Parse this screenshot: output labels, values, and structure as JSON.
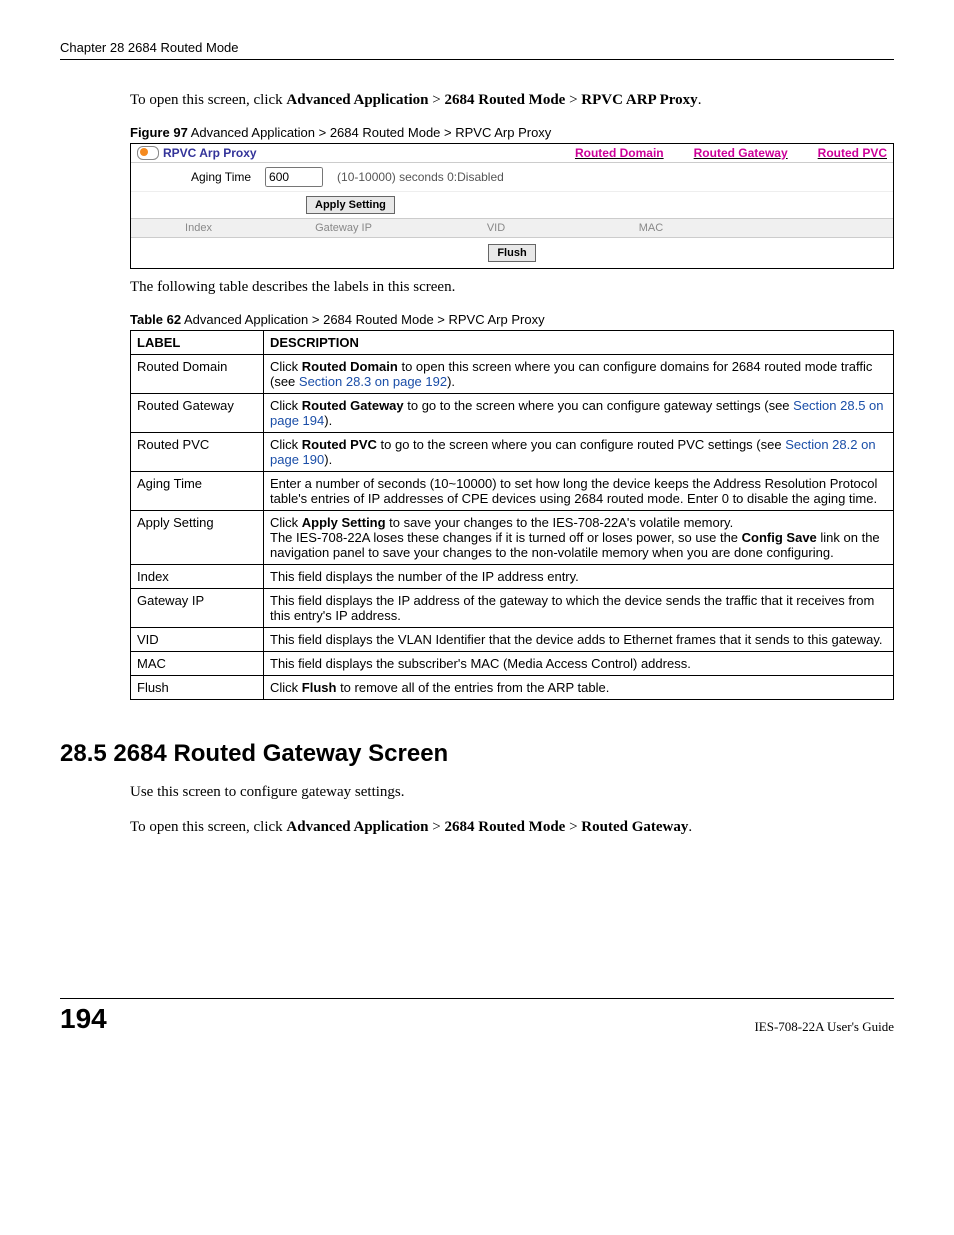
{
  "header": {
    "chapter": "Chapter 28 2684 Routed Mode"
  },
  "intro": {
    "prefix": "To open this screen, click ",
    "path1": "Advanced Application",
    "sep": " > ",
    "path2": "2684 Routed Mode",
    "path3": "RPVC ARP Proxy",
    "period": "."
  },
  "figure": {
    "caption_b": "Figure 97",
    "caption_r": "   Advanced Application > 2684 Routed Mode > RPVC Arp Proxy",
    "title": "RPVC Arp Proxy",
    "links": [
      "Routed Domain",
      "Routed Gateway",
      "Routed PVC"
    ],
    "aging_label": "Aging Time",
    "aging_value": "600",
    "aging_hint": "(10-10000) seconds  0:Disabled",
    "apply_btn": "Apply Setting",
    "cols": [
      "Index",
      "Gateway IP",
      "VID",
      "MAC"
    ],
    "flush_btn": "Flush"
  },
  "after_fig": "The following table describes the labels in this screen.",
  "table": {
    "caption_b": "Table 62",
    "caption_r": "   Advanced Application > 2684 Routed Mode > RPVC Arp Proxy",
    "head": [
      "LABEL",
      "DESCRIPTION"
    ],
    "rows": [
      {
        "label": "Routed Domain",
        "b1": "Routed Domain",
        "pre": "Click ",
        "post": " to open this screen where you can configure domains for 2684 routed mode traffic (see ",
        "xref": "Section 28.3 on page 192",
        "tail": ")."
      },
      {
        "label": "Routed Gateway",
        "b1": "Routed Gateway",
        "pre": "Click ",
        "post": " to go to the screen where you can configure gateway settings (see ",
        "xref": "Section 28.5 on page 194",
        "tail": ")."
      },
      {
        "label": "Routed PVC",
        "b1": "Routed PVC",
        "pre": "Click ",
        "post": " to go to the screen where you can configure routed PVC settings (see ",
        "xref": "Section 28.2 on page 190",
        "tail": ")."
      },
      {
        "label": "Aging Time",
        "plain": "Enter a number of seconds (10~10000) to set how long the device keeps the Address Resolution Protocol table's entries of IP addresses of CPE devices using 2684 routed mode. Enter 0 to disable the aging time."
      },
      {
        "label": "Apply Setting",
        "b1": "Apply Setting",
        "pre": "Click ",
        "post": " to save your changes to the IES-708-22A's volatile memory.",
        "extra_pre": "The IES-708-22A loses these changes if it is turned off or loses power, so use the ",
        "extra_b": "Config Save",
        "extra_post": " link on the navigation panel to save your changes to the non-volatile memory when you are done configuring."
      },
      {
        "label": "Index",
        "plain": "This field displays the number of the IP address entry."
      },
      {
        "label": "Gateway IP",
        "plain": "This field displays the IP address of the gateway to which the device sends the traffic that it receives from this entry's IP address."
      },
      {
        "label": "VID",
        "plain": "This field displays the VLAN Identifier that the device adds to Ethernet frames that it sends to this gateway."
      },
      {
        "label": "MAC",
        "plain": "This field displays the subscriber's MAC (Media Access Control) address."
      },
      {
        "label": "Flush",
        "b1": "Flush",
        "pre": "Click ",
        "post": " to remove all of the entries from the ARP table."
      }
    ]
  },
  "section": {
    "heading": "28.5  2684 Routed Gateway Screen",
    "p1": "Use this screen to configure gateway settings.",
    "p2_pre": "To open this screen, click ",
    "p2_a": "Advanced Application",
    "p2_b": "2684 Routed Mode",
    "p2_c": "Routed Gateway",
    "sep": " > "
  },
  "footer": {
    "page": "194",
    "guide": "IES-708-22A User's Guide"
  }
}
